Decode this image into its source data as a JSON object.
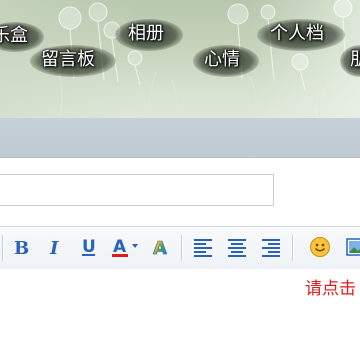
{
  "nav": {
    "items": [
      {
        "label": "乐盒"
      },
      {
        "label": "留言板"
      },
      {
        "label": "相册"
      },
      {
        "label": "心情"
      },
      {
        "label": "个人档"
      },
      {
        "label": "朋"
      }
    ]
  },
  "editor": {
    "title_value": "",
    "toolbar": [
      "bold",
      "italic",
      "underline",
      "font-color",
      "highlight-color",
      "align-left",
      "align-center",
      "align-right",
      "emoticon",
      "insert-image"
    ],
    "hint_text": "请点击"
  },
  "colors": {
    "hint": "#e01b1b",
    "toolbar_icon": "#2b62b8",
    "banner_green": "#b7c7ad"
  }
}
